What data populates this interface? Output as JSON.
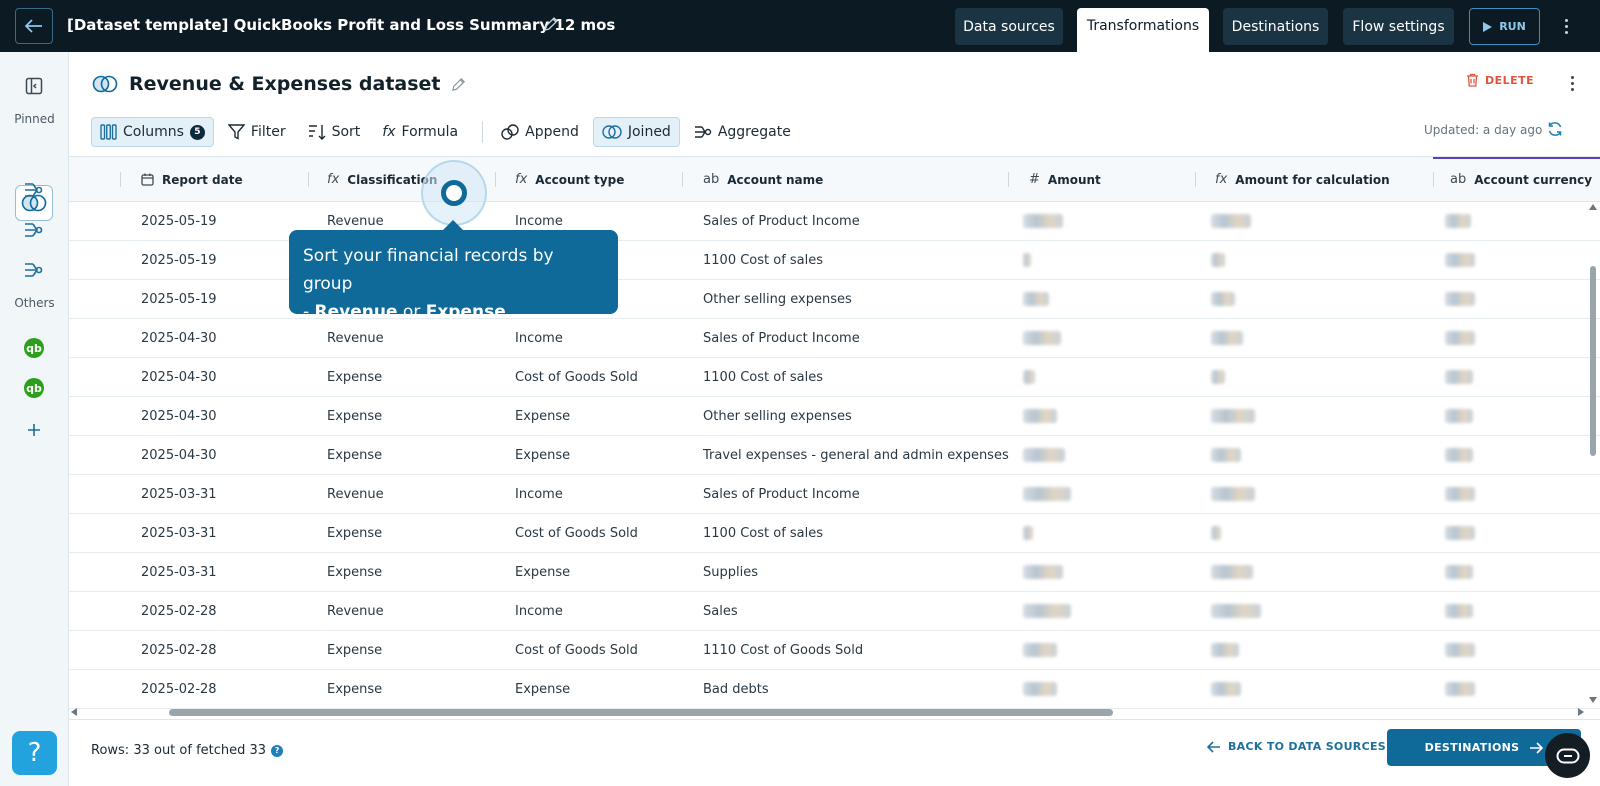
{
  "topbar": {
    "title": "[Dataset template] QuickBooks Profit and Loss Summary 12 mos",
    "tabs": [
      {
        "label": "Data sources",
        "active": false
      },
      {
        "label": "Transformations",
        "active": true
      },
      {
        "label": "Destinations",
        "active": false
      },
      {
        "label": "Flow settings",
        "active": false
      }
    ],
    "run_label": "RUN"
  },
  "sidebar": {
    "pinned_label": "Pinned",
    "others_label": "Others",
    "help_label": "?"
  },
  "dataset": {
    "title": "Revenue & Expenses dataset",
    "delete_label": "DELETE",
    "updated_label": "Updated: a day ago"
  },
  "toolbar": {
    "columns_label": "Columns",
    "columns_count": "5",
    "filter_label": "Filter",
    "sort_label": "Sort",
    "formula_label": "Formula",
    "append_label": "Append",
    "joined_label": "Joined",
    "aggregate_label": "Aggregate"
  },
  "table": {
    "columns": [
      {
        "label": "Report date",
        "icon": "calendar-icon",
        "glyph": "▦"
      },
      {
        "label": "Classification",
        "icon": "formula-icon",
        "glyph": "fx"
      },
      {
        "label": "Account type",
        "icon": "formula-icon",
        "glyph": "fx"
      },
      {
        "label": "Account name",
        "icon": "text-type-icon",
        "glyph": "ab"
      },
      {
        "label": "Amount",
        "icon": "number-type-icon",
        "glyph": "#"
      },
      {
        "label": "Amount for calculation",
        "icon": "formula-icon",
        "glyph": "fx"
      },
      {
        "label": "Account currency",
        "icon": "text-type-icon",
        "glyph": "ab"
      }
    ],
    "rows": [
      [
        "2025-05-19",
        "Revenue",
        "Income",
        "Sales of Product Income"
      ],
      [
        "2025-05-19",
        "",
        "",
        "1100 Cost of sales"
      ],
      [
        "2025-05-19",
        "",
        "",
        "Other selling expenses"
      ],
      [
        "2025-04-30",
        "Revenue",
        "Income",
        "Sales of Product Income"
      ],
      [
        "2025-04-30",
        "Expense",
        "Cost of Goods Sold",
        "1100 Cost of sales"
      ],
      [
        "2025-04-30",
        "Expense",
        "Expense",
        "Other selling expenses"
      ],
      [
        "2025-04-30",
        "Expense",
        "Expense",
        "Travel expenses - general and admin expenses"
      ],
      [
        "2025-03-31",
        "Revenue",
        "Income",
        "Sales of Product Income"
      ],
      [
        "2025-03-31",
        "Expense",
        "Cost of Goods Sold",
        "1100 Cost of sales"
      ],
      [
        "2025-03-31",
        "Expense",
        "Expense",
        "Supplies"
      ],
      [
        "2025-02-28",
        "Revenue",
        "Income",
        "Sales"
      ],
      [
        "2025-02-28",
        "Expense",
        "Cost of Goods Sold",
        "1110 Cost of Goods Sold"
      ],
      [
        "2025-02-28",
        "Expense",
        "Expense",
        "Bad debts"
      ]
    ]
  },
  "tooltip": {
    "line1": "Sort your financial records by group",
    "prefix": "- ",
    "word1": "Revenue",
    "middle": " or ",
    "word2": "Expense",
    "suffix": "."
  },
  "footer": {
    "rows_label": "Rows: 33 out of fetched 33",
    "info_glyph": "?",
    "back_label": "BACK TO DATA SOURCES",
    "destinations_label": "DESTINATIONS"
  },
  "colors": {
    "topbar_bg": "#0c1a24",
    "accent": "#0f6a99",
    "delete": "#e0553e",
    "quickbooks_green": "#2ca01c"
  }
}
